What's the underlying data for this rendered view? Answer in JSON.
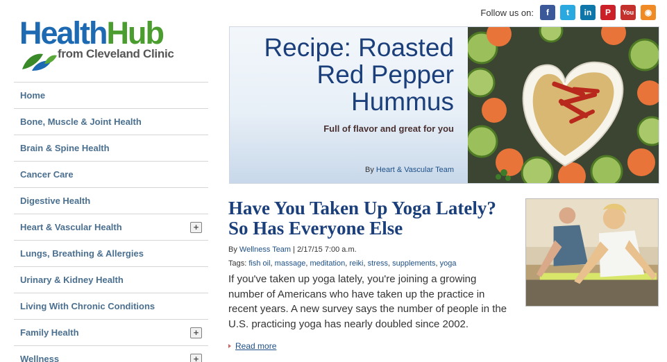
{
  "logo": {
    "part1": "Health",
    "part2": "Hub",
    "subtitle": "from Cleveland Clinic"
  },
  "follow": {
    "label": "Follow us on:",
    "icons": [
      {
        "name": "facebook-icon",
        "glyph": "f",
        "color": "#3b5998"
      },
      {
        "name": "twitter-icon",
        "glyph": "t",
        "color": "#2aa9e0"
      },
      {
        "name": "linkedin-icon",
        "glyph": "in",
        "color": "#0e76a8"
      },
      {
        "name": "pinterest-icon",
        "glyph": "P",
        "color": "#cb2027"
      },
      {
        "name": "youtube-icon",
        "glyph": "You",
        "color": "#c4302b"
      },
      {
        "name": "rss-icon",
        "glyph": "◉",
        "color": "#f08a24"
      }
    ]
  },
  "nav": {
    "items": [
      {
        "label": "Home"
      },
      {
        "label": "Bone, Muscle & Joint Health"
      },
      {
        "label": "Brain & Spine Health"
      },
      {
        "label": "Cancer Care"
      },
      {
        "label": "Digestive Health"
      },
      {
        "label": "Heart & Vascular Health",
        "expand": "+"
      },
      {
        "label": "Lungs, Breathing & Allergies"
      },
      {
        "label": "Urinary & Kidney Health"
      },
      {
        "label": "Living With Chronic Conditions"
      },
      {
        "label": "Family Health",
        "expand": "+"
      },
      {
        "label": "Wellness",
        "expand": "+"
      }
    ]
  },
  "hero": {
    "title": "Recipe: Roasted Red Pepper Hummus",
    "subtitle": "Full of flavor and great for you",
    "by_prefix": "By ",
    "author": "Heart & Vascular Team"
  },
  "article": {
    "title": "Have You Taken Up Yoga Lately? So Has Everyone Else",
    "by_prefix": "By ",
    "author": "Wellness Team",
    "date": " | 2/17/15 7:00 a.m.",
    "tags_label": "Tags: ",
    "tags": [
      "fish oil",
      "massage",
      "meditation",
      "reiki",
      "stress",
      "supplements",
      "yoga"
    ],
    "body": "If you've taken up yoga lately, you're joining a growing number of Americans who have taken up the practice in recent years. A new survey says the number of people in the U.S. practicing yoga has nearly doubled since 2002.",
    "read_more": "Read more"
  },
  "colors": {
    "brand_blue": "#1d6ab3",
    "brand_green": "#4a9d2e",
    "link": "#1d4f86",
    "headline": "#1b3f7a"
  }
}
